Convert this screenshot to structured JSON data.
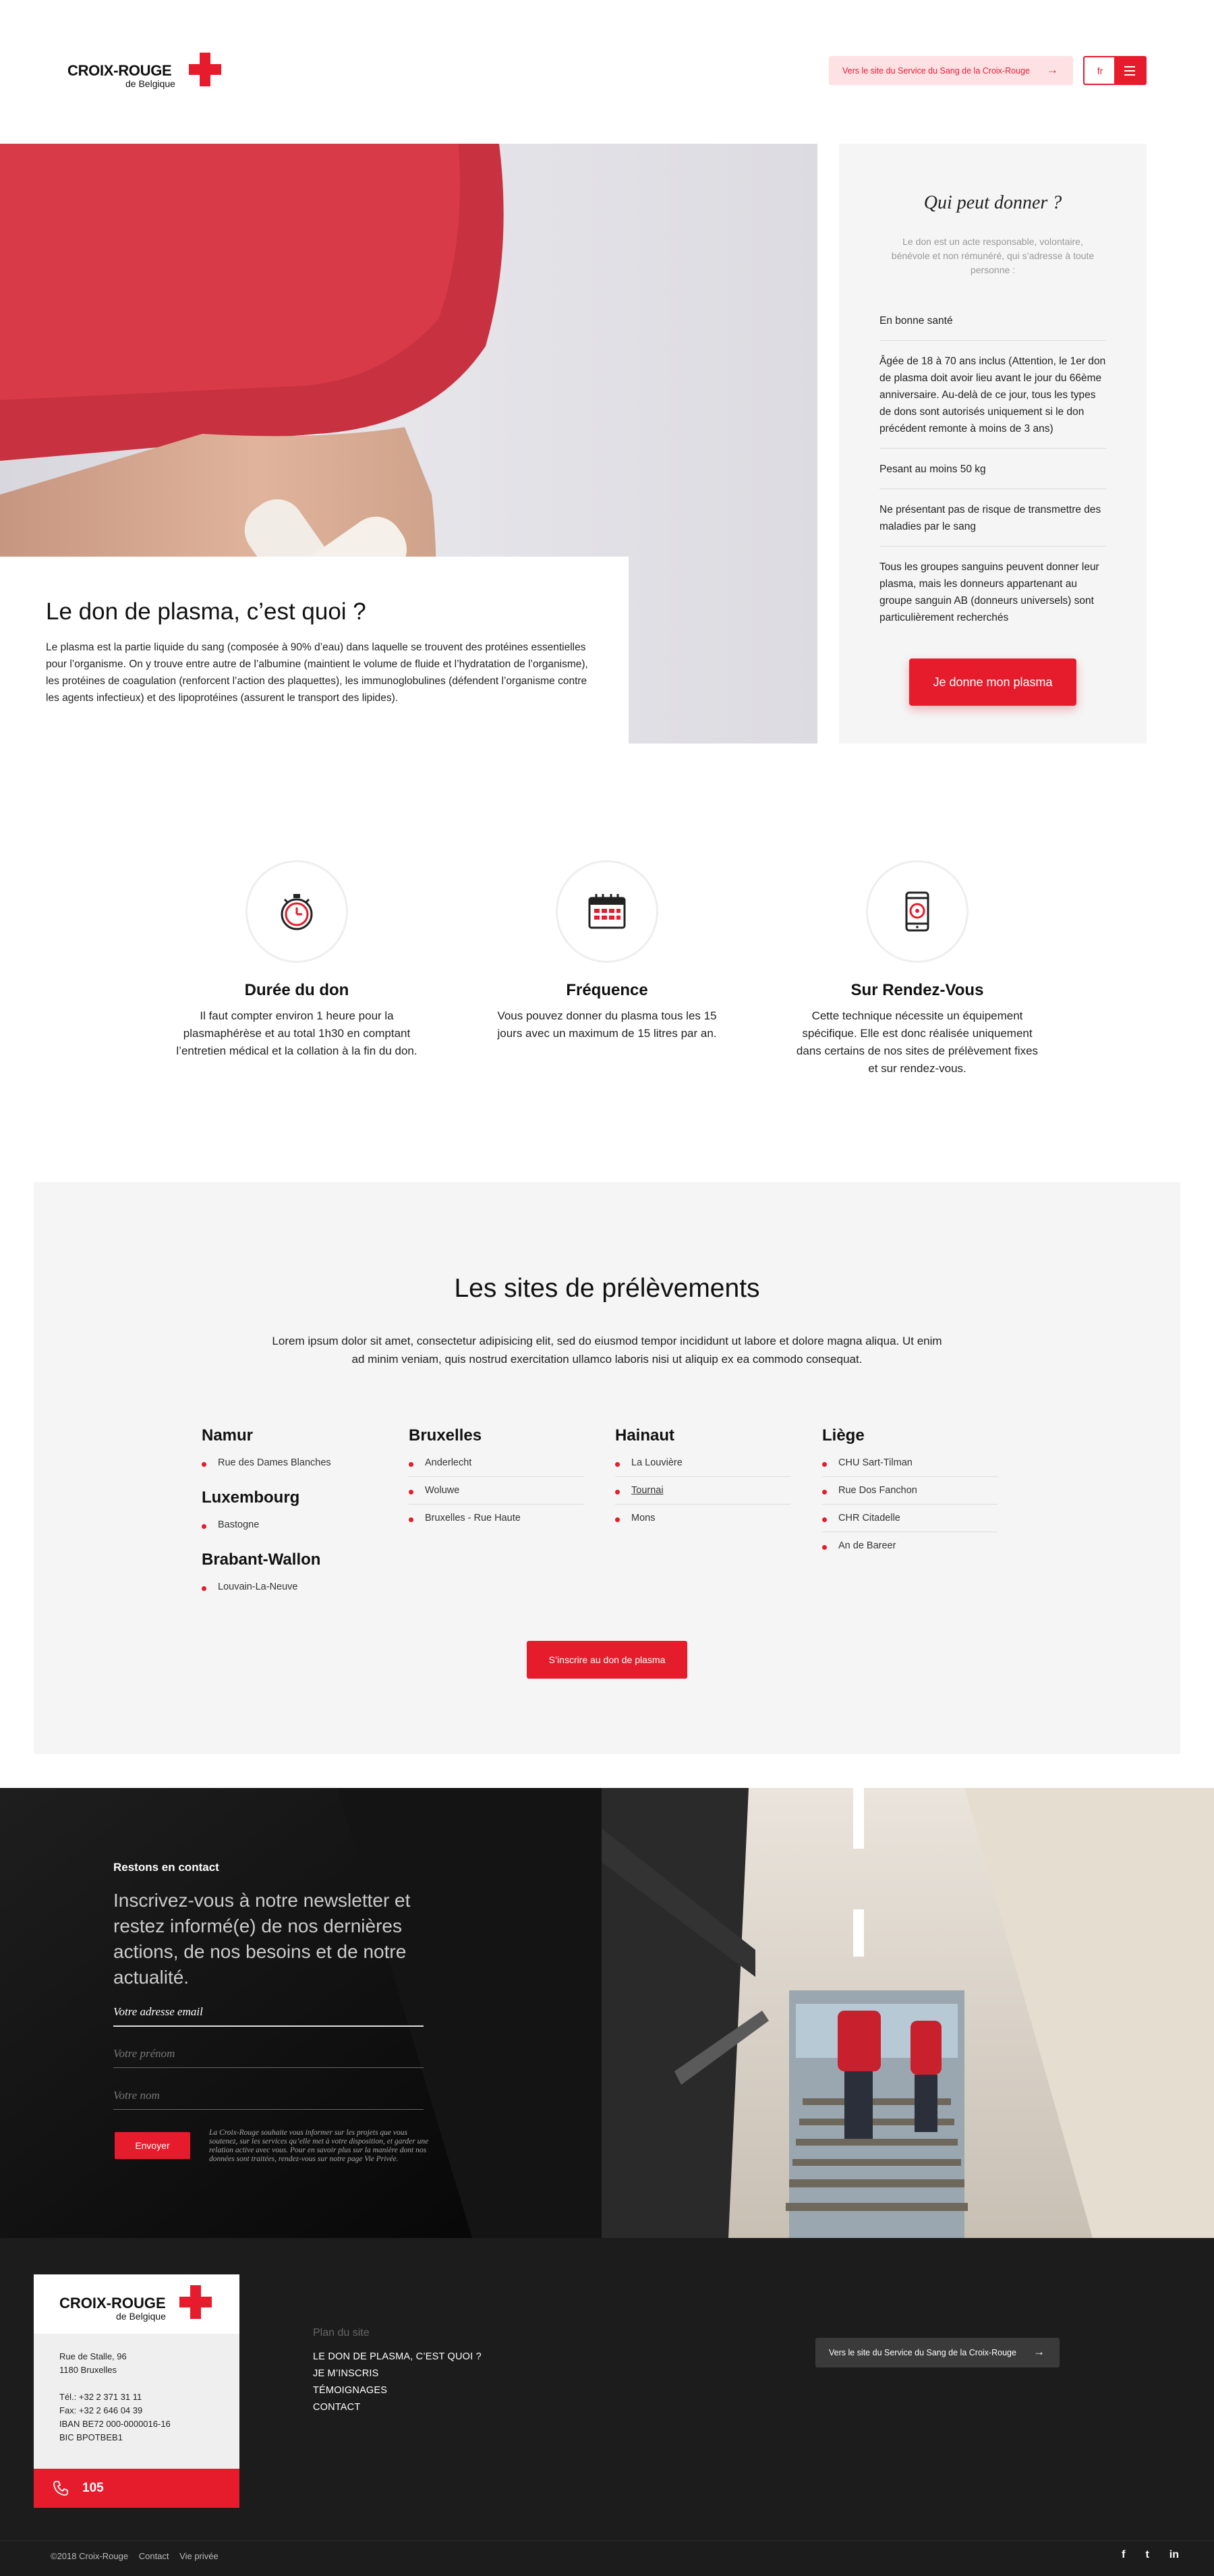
{
  "header": {
    "logo_line1": "CROIX-ROUGE",
    "logo_line2": "de Belgique",
    "external_link": "Vers le site du Service du Sang de la Croix-Rouge",
    "lang": "fr"
  },
  "hero": {
    "title": "Le don de plasma, c’est quoi ?",
    "text": "Le plasma est la partie liquide du sang (composée à 90% d’eau) dans laquelle se trouvent des protéines essentielles pour l’organisme. On y trouve entre autre de l’albumine (maintient le volume de fluide et l’hydratation de l’organisme), les protéines de coagulation (renforcent l’action des plaquettes), les immunoglobulines (défendent l’organisme contre les agents infectieux) et des lipoprotéines  (assurent le transport des lipides)."
  },
  "who": {
    "title": "Qui peut donner ?",
    "intro": "Le don est un acte responsable, volontaire, bénévole et non rémunéré, qui s’adresse à toute personne :",
    "criteria": [
      "En bonne santé",
      "Âgée de 18 à 70 ans inclus (Attention, le 1er don de plasma doit avoir lieu avant le jour du 66ème anniversaire. Au-delà de ce jour, tous les types de dons sont autorisés uniquement si le don précédent remonte à moins de 3 ans)",
      "Pesant au moins 50 kg",
      "Ne présentant pas de risque de transmettre des maladies par le sang",
      "Tous les groupes sanguins peuvent donner leur plasma, mais les donneurs appartenant au groupe sanguin AB (donneurs universels) sont particulièrement recherchés"
    ],
    "cta": "Je donne mon plasma"
  },
  "features": [
    {
      "icon": "stopwatch-icon",
      "title": "Durée du don",
      "text": "Il faut compter environ 1 heure pour la plasmaphérèse et au total 1h30 en comptant l’entretien médical et la collation à la fin du don."
    },
    {
      "icon": "calendar-icon",
      "title": "Fréquence",
      "text": "Vous pouvez donner du plasma tous les 15 jours avec un maximum de 15 litres par an."
    },
    {
      "icon": "phone-appointment-icon",
      "title": "Sur Rendez-Vous",
      "text": "Cette technique nécessite un équipement spécifique. Elle est donc réalisée uniquement dans certains de nos sites de prélèvement fixes et sur rendez-vous."
    }
  ],
  "sites": {
    "title": "Les sites de prélèvements",
    "lead": "Lorem ipsum dolor sit amet, consectetur adipisicing elit, sed do eiusmod tempor incididunt ut labore et dolore magna aliqua. Ut enim ad minim veniam, quis nostrud exercitation ullamco laboris nisi ut aliquip ex ea commodo consequat.",
    "namur": {
      "name": "Namur",
      "items": [
        "Rue des Dames Blanches"
      ]
    },
    "luxembourg": {
      "name": "Luxembourg",
      "items": [
        "Bastogne"
      ]
    },
    "brabant": {
      "name": "Brabant-Wallon",
      "items": [
        "Louvain-La-Neuve"
      ]
    },
    "bruxelles": {
      "name": "Bruxelles",
      "items": [
        "Anderlecht",
        "Woluwe",
        "Bruxelles - Rue Haute"
      ]
    },
    "hainaut": {
      "name": "Hainaut",
      "items": [
        "La Louvière",
        "Tournai",
        "Mons"
      ]
    },
    "liege": {
      "name": "Liège",
      "items": [
        "CHU Sart-Tilman",
        "Rue Dos Fanchon",
        "CHR Citadelle",
        "An de Bareer"
      ]
    },
    "cta": "S’inscrire au don de plasma"
  },
  "newsletter": {
    "label": "Restons en contact",
    "headline": "Inscrivez-vous à notre newsletter et restez informé(e) de nos dernières actions, de nos besoins et de notre actualité.",
    "email_placeholder": "Votre adresse email",
    "firstname_placeholder": "Votre prénom",
    "lastname_placeholder": "Votre nom",
    "send": "Envoyer",
    "legal": "La Croix-Rouge souhaite vous informer sur les projets que vous soutenez, sur les services qu’elle met à votre disposition, et garder une relation active avec vous. Pour en savoir plus sur la manière dont nos données sont traitées, rendez-vous sur notre page Vie Privée."
  },
  "footer": {
    "address": [
      "Rue de Stalle, 96",
      "1180 Bruxelles",
      "",
      "Tél.: +32 2 371 31 11",
      "Fax: +32 2 646 04 39",
      "IBAN BE72 000-0000016-16",
      "BIC BPOTBEB1"
    ],
    "emergency": "105",
    "plan_title": "Plan du site",
    "plan_links": [
      "LE DON DE PLASMA, C’EST QUOI ?",
      "JE M’INSCRIS",
      "TÉMOIGNAGES",
      "CONTACT"
    ],
    "external_link": "Vers le site du Service du Sang de la Croix-Rouge",
    "copyright": "©2018 Croix-Rouge",
    "contact": "Contact",
    "privacy": "Vie privée",
    "social": [
      "f",
      "t",
      "in"
    ]
  },
  "colors": {
    "brand_red": "#e61b2b",
    "dark": "#1c1c1c",
    "light_grey": "#f5f5f5"
  }
}
